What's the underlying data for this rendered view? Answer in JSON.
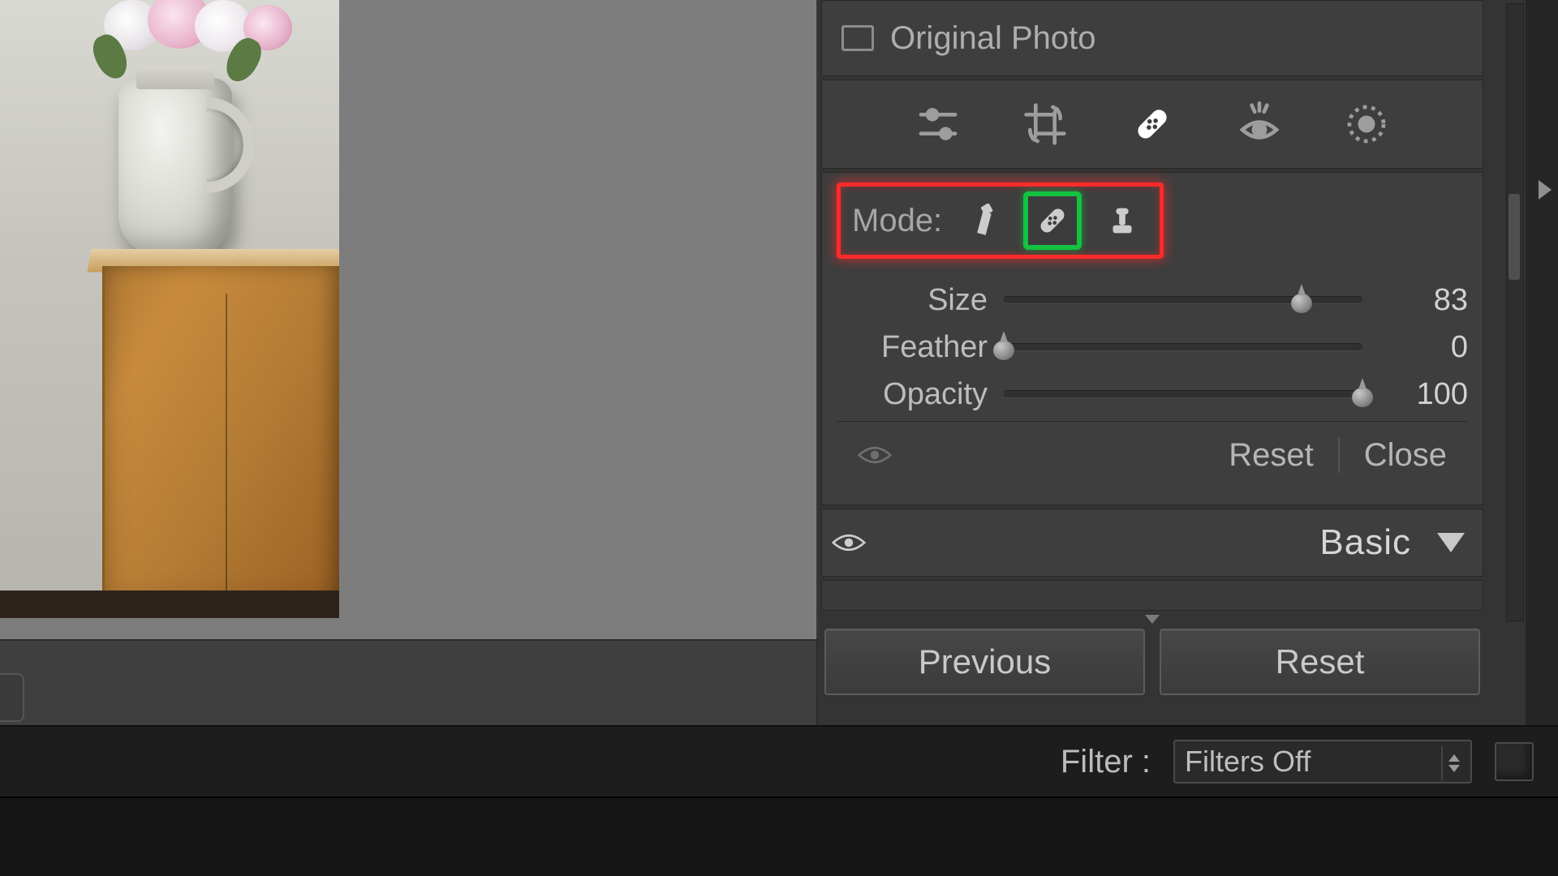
{
  "colors": {
    "highlight_red": "#ff2a2a",
    "highlight_green": "#12c240"
  },
  "original_photo": {
    "label": "Original Photo",
    "checked": false
  },
  "tool_strip": {
    "tools": [
      {
        "name": "edit-sliders-icon",
        "active": false
      },
      {
        "name": "crop-icon",
        "active": false
      },
      {
        "name": "healing-icon",
        "active": true
      },
      {
        "name": "redeye-icon",
        "active": false
      },
      {
        "name": "masking-icon",
        "active": false
      }
    ]
  },
  "healing": {
    "mode_label": "Mode:",
    "modes": [
      {
        "name": "content-aware-remove-icon",
        "selected": false
      },
      {
        "name": "heal-icon",
        "selected": true
      },
      {
        "name": "clone-stamp-icon",
        "selected": false
      }
    ],
    "sliders": {
      "size": {
        "label": "Size",
        "value": 83,
        "min": 0,
        "max": 100
      },
      "feather": {
        "label": "Feather",
        "value": 0,
        "min": 0,
        "max": 100
      },
      "opacity": {
        "label": "Opacity",
        "value": 100,
        "min": 0,
        "max": 100
      }
    },
    "reset_label": "Reset",
    "close_label": "Close"
  },
  "basic_panel": {
    "label": "Basic",
    "expanded": true
  },
  "footer_buttons": {
    "previous": "Previous",
    "reset": "Reset"
  },
  "filter_bar": {
    "label": "Filter :",
    "selected": "Filters Off"
  }
}
